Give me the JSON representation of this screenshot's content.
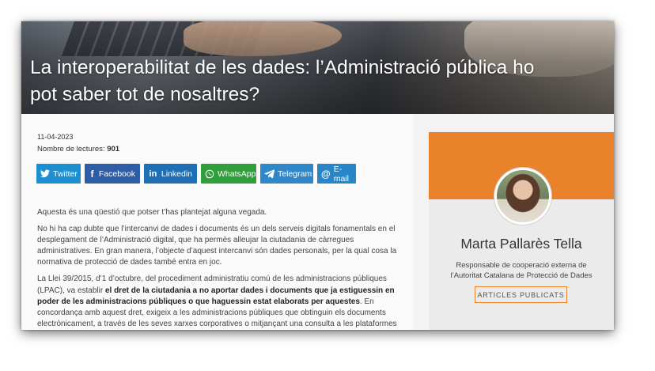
{
  "article": {
    "title": "La interoperabilitat de les dades: l’Administració pública ho pot saber tot de nosaltres?",
    "date": "11-04-2023",
    "reads_label": "Nombre de lectures:",
    "reads_count": "901",
    "paragraphs": {
      "p1": "Aquesta és una qüestió que potser t’has plantejat alguna vegada.",
      "p2": "No hi ha cap dubte que l’intercanvi de dades i documents és un dels serveis digitals fonamentals en el desplegament de l’Administració digital, que ha permès alleujar la ciutadania de càrregues administratives. En gran manera, l’objecte d’aquest intercanvi són dades personals, per la qual cosa la normativa de protecció de dades també entra en joc.",
      "p3_a": "La Llei 39/2015, d’1 d’octubre, del procediment administratiu comú de les administracions públiques (LPAC), va establir ",
      "p3_b": "el dret de la ciutadania a no aportar dades i documents que ja estiguessin en poder de les administracions públiques o que haguessin estat elaborats per aquestes",
      "p3_c": ". En concordança amb aquest dret, exigeix a les administracions públiques que obtinguin els documents electrònicament, a través de les seves xarxes corporatives o mitjançant una consulta a les plataformes d’intermediació de dades o altres sistemes electrònics habilitats a aquest efecte (art. 28 de la LPAC). És a dir, són les administracions públiques les que,"
    }
  },
  "share": {
    "twitter": "Twitter",
    "facebook": "Facebook",
    "linkedin": "Linkedin",
    "whatsapp": "WhatsApp",
    "telegram": "Telegram",
    "email": "E-mail"
  },
  "author": {
    "name": "Marta Pallarès Tella",
    "role": "Responsable de cooperació externa de l’Autoritat Catalana de Protecció de Dades",
    "articles_button": "ARTICLES PUBLICATS"
  },
  "colors": {
    "accent_orange": "#e9822b",
    "twitter": "#1d8fd0",
    "facebook": "#2e5da6",
    "linkedin": "#1f6fb5",
    "whatsapp": "#2f9e3b",
    "telegram": "#2f87c9",
    "email": "#2785c8"
  }
}
